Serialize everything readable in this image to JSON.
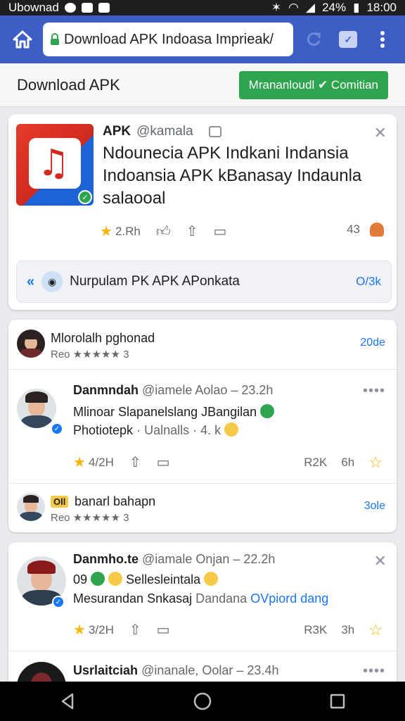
{
  "status_bar": {
    "left_text": "Ubownad",
    "battery": "24%",
    "time": "18:00"
  },
  "browser": {
    "url": "Download APK Indoasa Imprieak/"
  },
  "header": {
    "title": "Download APK",
    "continue_label": "Mrananloudl  ✔ Comitian"
  },
  "app_card": {
    "name": "APK",
    "handle": "@kamala",
    "description": "Ndounecia APK Indkani Indansia Indoansia APK kBanasay Indaunla salaooal",
    "rating": "2.Rh",
    "count": "43",
    "info_text": "Nurpulam PK APK APonkata",
    "info_link": "O/3k"
  },
  "review_card": {
    "row1": {
      "name": "Mlorolalh pghonad",
      "sub": "Reo ★★★★★ 3",
      "link": "20de"
    },
    "post": {
      "author": "Danmndah",
      "meta": "@iamele  Aolao  –  23.2h",
      "line1": "Mlinoar Slapanelslang JBangilan",
      "line2a": "Photiotepk",
      "line2b": " · Ualnalls  ·  4. k",
      "rating": "4/2H",
      "stat1": "R2K",
      "stat2": "6h"
    },
    "row2": {
      "badge": "Oll",
      "name": "banarl bahapn",
      "sub": "Reo ★★★★★ 3",
      "link": "3ole"
    }
  },
  "post_card": {
    "author": "Danmho.te",
    "meta": "@iamale  Onjan  –  22.2h",
    "line1_prefix": "09",
    "line1": "Sellesleintala",
    "line2": "Mesurandan Snkasaj",
    "line2_muted": " Dandana ",
    "line2_link": "OVpiord dang",
    "rating": "3/2H",
    "stat1": "R3K",
    "stat2": "3h",
    "next_author": "Usrlaitciah",
    "next_meta": "@inanale, Oolar  –  23.4h"
  },
  "colors": {
    "brand_blue": "#3d5fc5",
    "continue_green": "#2ea44f",
    "link_blue": "#1877f2"
  }
}
